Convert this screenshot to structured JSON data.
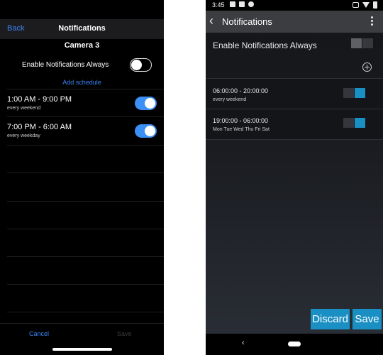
{
  "ios": {
    "nav": {
      "back_label": "Back",
      "title": "Notifications"
    },
    "camera_name": "Camera 3",
    "enable_always": {
      "label": "Enable Notifications Always",
      "on": false
    },
    "add_schedule_label": "Add schedule",
    "schedules": [
      {
        "time": "1:00 AM - 9:00 PM",
        "days": "every weekend",
        "enabled": true
      },
      {
        "time": "7:00 PM - 6:00 AM",
        "days": "every weekday",
        "enabled": true
      }
    ],
    "footer": {
      "cancel_label": "Cancel",
      "save_label": "Save"
    },
    "colors": {
      "accent": "#3b82f6",
      "switch_on": "#3b8ff5",
      "background": "#000000"
    }
  },
  "android": {
    "status": {
      "time": "3:45"
    },
    "toolbar": {
      "title": "Notifications"
    },
    "enable_always": {
      "label": "Enable Notifications Always",
      "on": false
    },
    "schedules": [
      {
        "time": "06:00:00 - 20:00:00",
        "days": "every weekend",
        "enabled": true
      },
      {
        "time": "19:00:00 - 06:00:00",
        "days": "Mon Tue Wed Thu Fri Sat",
        "enabled": true
      }
    ],
    "buttons": {
      "discard_label": "Discard",
      "save_label": "Save"
    },
    "colors": {
      "accent": "#1a8fc4",
      "toolbar": "#3c3d40"
    }
  }
}
